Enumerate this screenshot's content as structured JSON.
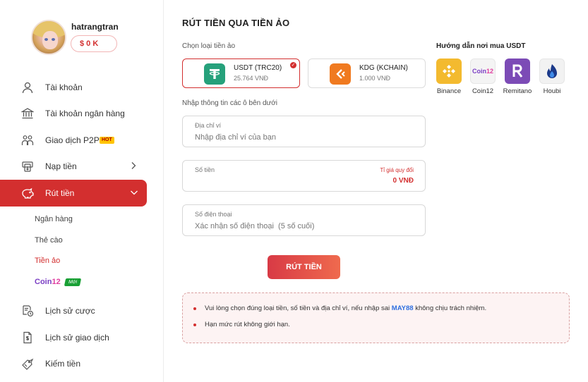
{
  "profile": {
    "username": "hatrangtran",
    "balance": "$ 0 K"
  },
  "sidebar": {
    "items": [
      {
        "label": "Tài khoản",
        "icon": "user-icon"
      },
      {
        "label": "Tài khoản ngân hàng",
        "icon": "bank-icon"
      },
      {
        "label": "Giao dịch P2P",
        "icon": "p2p-icon",
        "badge": "HOT"
      },
      {
        "label": "Nạp tiền",
        "icon": "deposit-icon"
      },
      {
        "label": "Rút tiền",
        "icon": "piggy-bank-icon"
      },
      {
        "label": "Lịch sử cược",
        "icon": "bet-history-icon"
      },
      {
        "label": "Lịch sử giao dịch",
        "icon": "transaction-history-icon"
      },
      {
        "label": "Kiếm tiền",
        "icon": "earn-icon"
      }
    ],
    "sub_items": [
      "Ngân hàng",
      "Thẻ cào",
      "Tiền ảo"
    ],
    "coin12": {
      "logo_a": "Coin",
      "logo_b": "12",
      "badge": "Mới"
    }
  },
  "main": {
    "title": "RÚT TIỀN QUA TIỀN ẢO",
    "choose_label": "Chọn loại tiền ảo",
    "coins": [
      {
        "name": "USDT (TRC20)",
        "price": "25.764 VNĐ",
        "color": "#26a17b",
        "symbol": "T"
      },
      {
        "name": "KDG (KCHAIN)",
        "price": "1.000 VNĐ",
        "color": "#f07a20",
        "symbol": "K"
      }
    ],
    "info_label": "Nhập thông tin các ô bên dưới",
    "wallet": {
      "label": "Địa chỉ ví",
      "placeholder": "Nhập địa chỉ ví của bạn"
    },
    "amount": {
      "label": "Số tiền",
      "rate_label": "Tỉ giá quy đổi",
      "rate_value": "0 VNĐ"
    },
    "phone": {
      "label": "Số điện thoại",
      "placeholder": "Xác nhận số điện thoại  (5 số cuối)"
    },
    "submit_label": "RÚT TIỀN",
    "notice": {
      "line1_a": "Vui lòng chọn đúng loại tiền, số tiền và địa chỉ ví, nếu nhập sai ",
      "line1_code": "MAY88",
      "line1_b": " không chịu trách nhiệm.",
      "line2": "Hạn mức rút không giới hạn."
    },
    "guide": {
      "title": "Hướng dẫn nơi mua USDT",
      "exchanges": [
        {
          "name": "Binance",
          "color": "#f3ba2f"
        },
        {
          "name": "Coin12",
          "color": "#f4f4f4"
        },
        {
          "name": "Remitano",
          "color": "#7c4bb6"
        },
        {
          "name": "Houbi",
          "color": "#f2f2f2"
        }
      ]
    }
  },
  "colors": {
    "accent": "#d32f2f",
    "link": "#2e6fe0"
  }
}
